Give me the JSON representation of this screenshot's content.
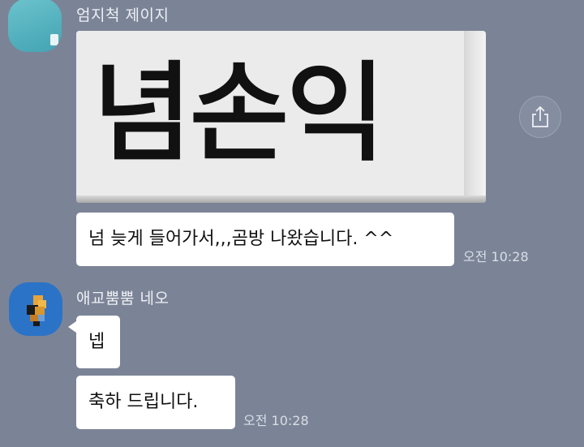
{
  "colors": {
    "background": "#7b8497",
    "bubble": "#ffffff",
    "name_text": "#eef0f4",
    "time_text": "#d9dde5"
  },
  "messages": [
    {
      "sender": "엄지척 제이지",
      "avatar_icon": "teal-avatar-icon",
      "image_text": "념손익",
      "text": "넘 늦게 들어가서,,,곰방 나왔습니다. ^^",
      "time": "오전 10:28"
    },
    {
      "sender": "애교뿜뿜 네오",
      "avatar_icon": "pixel-avatar-icon",
      "text_1": "넵",
      "text_2": "축하 드립니다.",
      "time": "오전 10:28"
    }
  ],
  "share_icon": "share-icon"
}
